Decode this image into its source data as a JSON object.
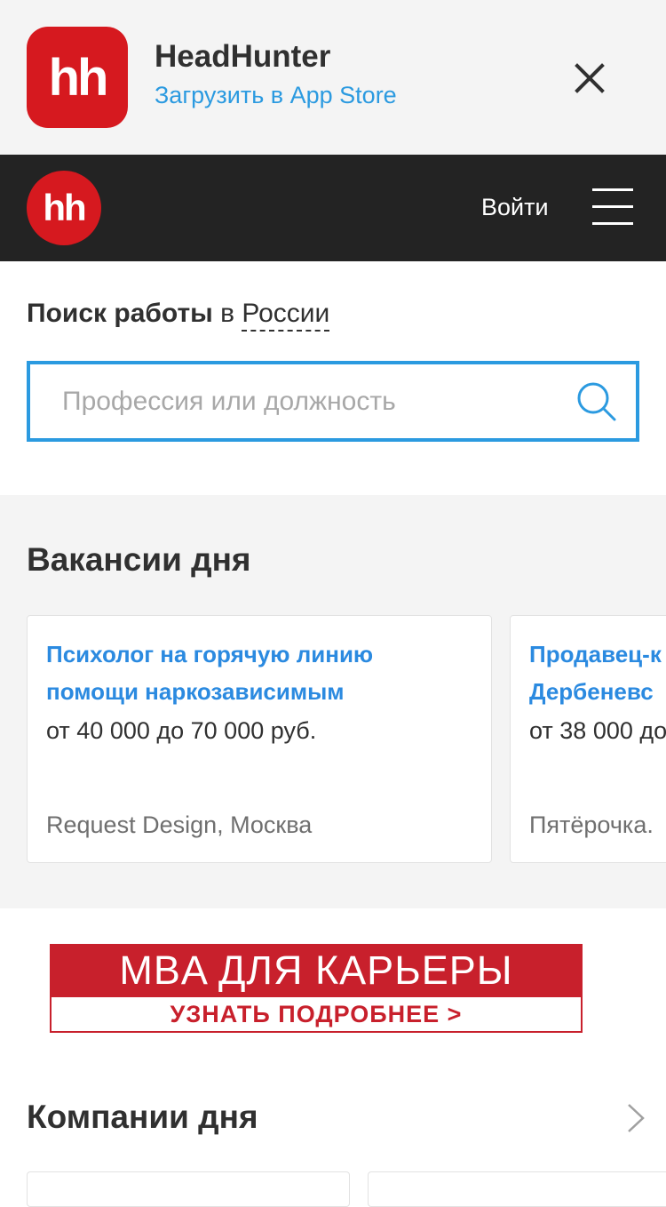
{
  "app_banner": {
    "icon_text": "hh",
    "app_name": "HeadHunter",
    "store_link": "Загрузить в App Store"
  },
  "header": {
    "logo_text": "hh",
    "login": "Войти"
  },
  "search": {
    "title_bold": "Поиск работы",
    "title_prep": " в ",
    "region": "России",
    "placeholder": "Профессия или должность"
  },
  "vacancies": {
    "title": "Вакансии дня",
    "items": [
      {
        "title_line1": "Психолог на горячую линию",
        "title_line2": "помощи наркозависимым",
        "salary": "от 40 000 до 70 000 руб.",
        "company": "Request Design, Москва"
      },
      {
        "title_line1": "Продавец-к",
        "title_line2": "Дербеневс",
        "salary": "от 38 000 до",
        "company": "Пятёрочка."
      }
    ]
  },
  "ad": {
    "headline": "MBA ДЛЯ КАРЬЕРЫ",
    "cta": "УЗНАТЬ ПОДРОБНЕЕ >"
  },
  "companies": {
    "title": "Компании дня"
  },
  "colors": {
    "brand_red": "#d6191f",
    "link_blue": "#2b9ae0",
    "header_bg": "#232323",
    "section_bg": "#f4f4f4"
  },
  "icons": [
    "close-icon",
    "menu-icon",
    "search-icon",
    "chevron-right-icon"
  ]
}
